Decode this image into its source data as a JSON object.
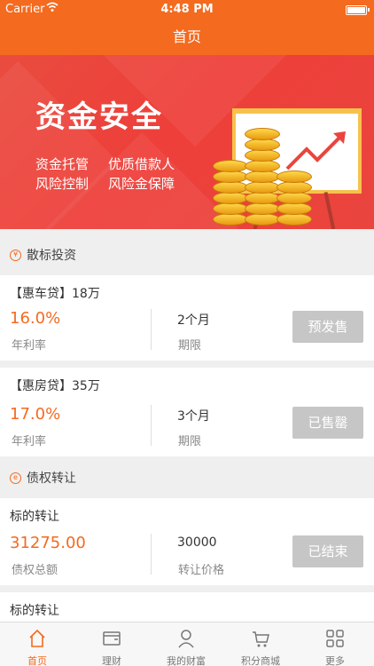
{
  "status_bar": {
    "carrier": "Carrier",
    "time": "4:48 PM"
  },
  "nav": {
    "title": "首页"
  },
  "banner": {
    "title": "资金安全",
    "features": [
      "资金托管",
      "优质借款人",
      "风险控制",
      "风险金保障"
    ]
  },
  "sections": {
    "scattered": {
      "title": "散标投资",
      "icon": "yuan-icon"
    },
    "transfer": {
      "title": "债权转让",
      "icon": "transfer-icon"
    }
  },
  "loans": [
    {
      "title": "【惠车贷】18万",
      "rate": "16.0%",
      "rate_label": "年利率",
      "term": "2个月",
      "term_label": "期限",
      "status": "预发售"
    },
    {
      "title": "【惠房贷】35万",
      "rate": "17.0%",
      "rate_label": "年利率",
      "term": "3个月",
      "term_label": "期限",
      "status": "已售罄"
    }
  ],
  "transfers": [
    {
      "title": "标的转让",
      "amount": "31275.00",
      "amount_label": "债权总额",
      "price": "30000",
      "price_label": "转让价格",
      "status": "已结束"
    },
    {
      "title": "标的转让"
    }
  ],
  "tabs": [
    {
      "label": "首页",
      "icon": "home-icon",
      "active": true
    },
    {
      "label": "理财",
      "icon": "wallet-icon",
      "active": false
    },
    {
      "label": "我的财富",
      "icon": "person-icon",
      "active": false
    },
    {
      "label": "积分商城",
      "icon": "cart-icon",
      "active": false
    },
    {
      "label": "更多",
      "icon": "grid-icon",
      "active": false
    }
  ],
  "colors": {
    "accent": "#f46a1f",
    "banner": "#ee3f3a",
    "disabled_button": "#c6c6c6"
  }
}
